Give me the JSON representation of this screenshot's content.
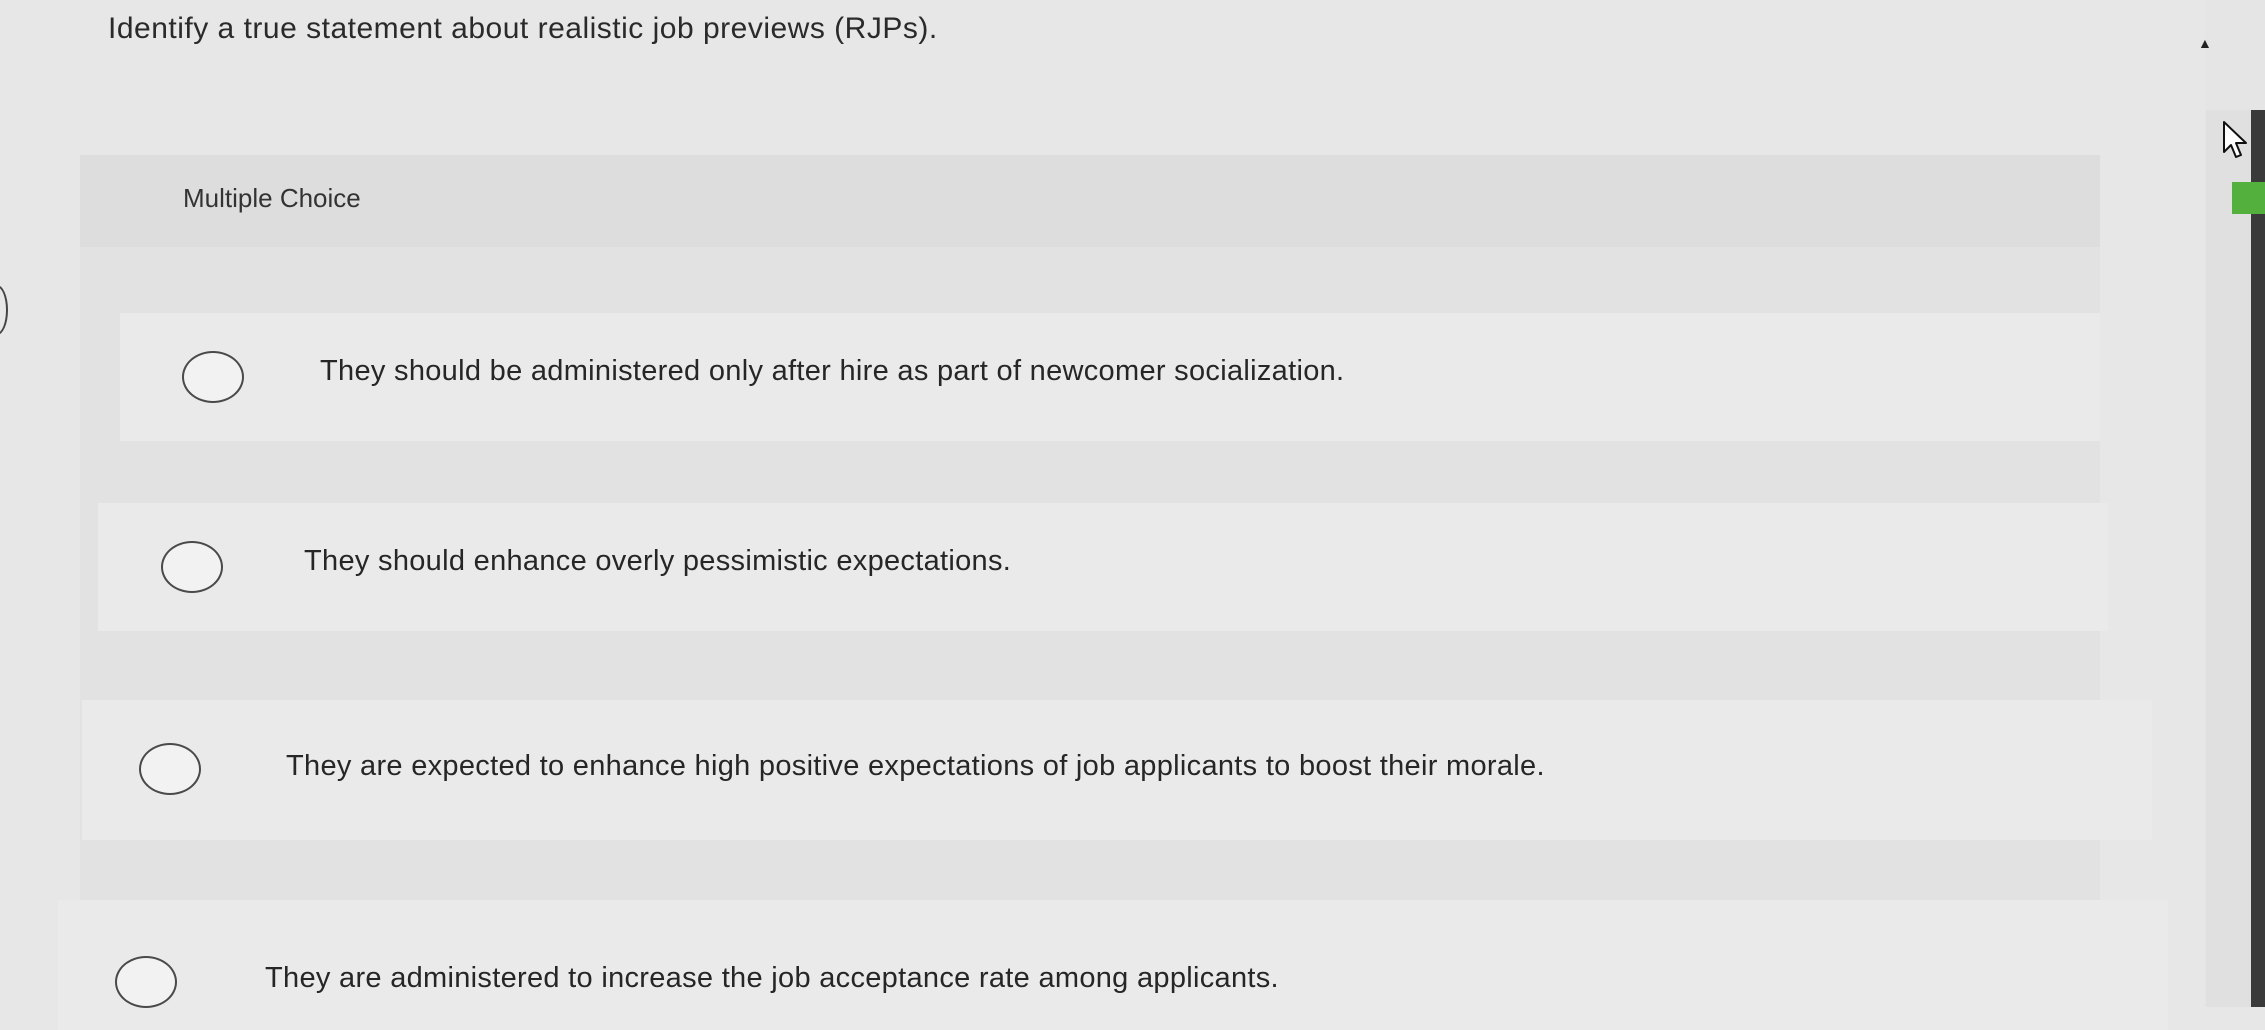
{
  "question": {
    "text": "Identify a true statement about realistic job previews (RJPs)."
  },
  "multiple_choice_label": "Multiple Choice",
  "choices": [
    {
      "text": "They should be administered only after hire as part of newcomer socialization.",
      "selected": false
    },
    {
      "text": "They should enhance overly pessimistic expectations.",
      "selected": false
    },
    {
      "text": "They are expected to enhance high positive expectations of job applicants to boost their morale.",
      "selected": false
    },
    {
      "text": "They are administered to increase the job acceptance rate among applicants.",
      "selected": false
    }
  ],
  "icons": {
    "scroll_up": "triangle-up",
    "cursor": "arrow-pointer",
    "radio": "empty-circle"
  },
  "colors": {
    "background": "#e6e7e6",
    "scroll_thumb": "#3a3a3a",
    "accent_marker": "#54b03d"
  }
}
